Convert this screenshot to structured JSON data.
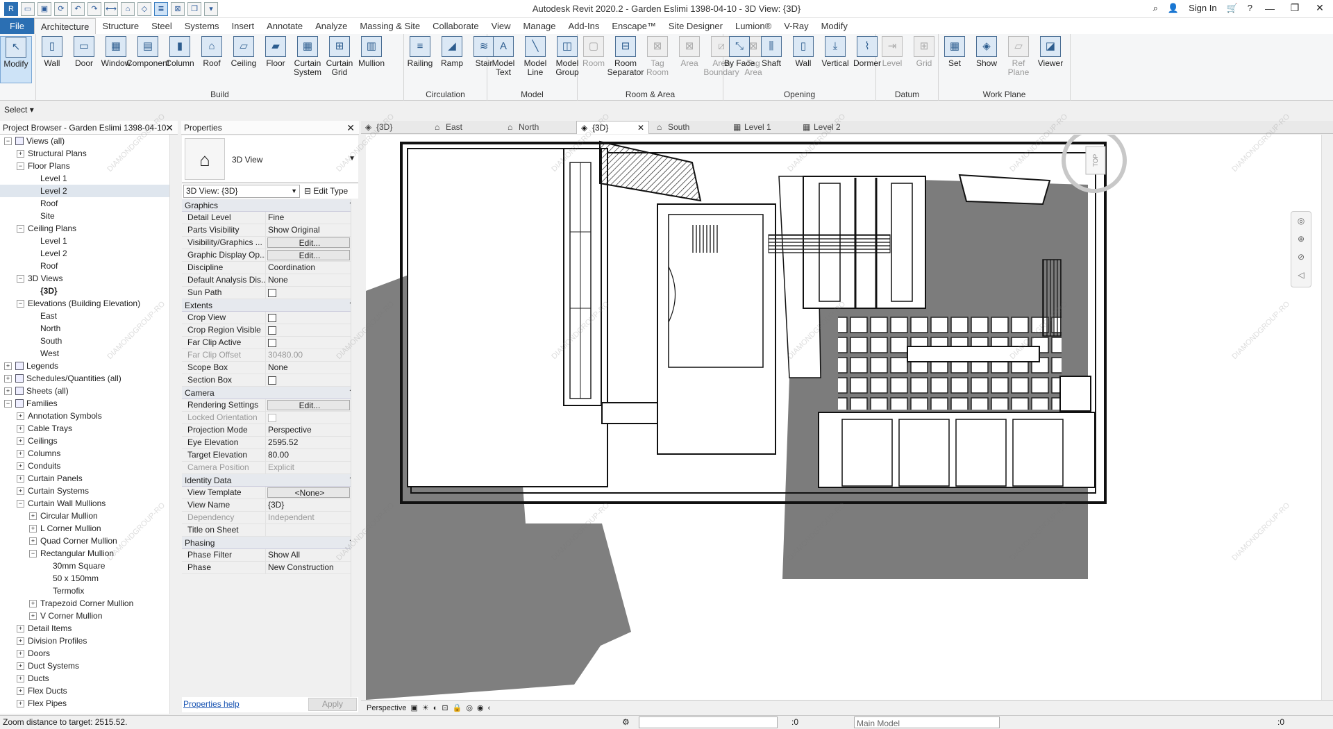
{
  "title": {
    "text": "Autodesk Revit 2020.2 - Garden Eslimi 1398-04-10 - 3D View: {3D}",
    "sign_in": "Sign In"
  },
  "menu": [
    "File",
    "Architecture",
    "Structure",
    "Steel",
    "Systems",
    "Insert",
    "Annotate",
    "Analyze",
    "Massing & Site",
    "Collaborate",
    "View",
    "Manage",
    "Add-Ins",
    "Enscape™",
    "Site Designer",
    "Lumion®",
    "V-Ray",
    "Modify"
  ],
  "ribbon": {
    "select_label": "Select",
    "groups": [
      {
        "name": "",
        "tools": [
          "Modify"
        ]
      },
      {
        "name": "Build",
        "tools": [
          "Wall",
          "Door",
          "Window",
          "Component",
          "Column",
          "Roof",
          "Ceiling",
          "Floor",
          "Curtain System",
          "Curtain Grid",
          "Mullion"
        ]
      },
      {
        "name": "Circulation",
        "tools": [
          "Railing",
          "Ramp",
          "Stair"
        ]
      },
      {
        "name": "Model",
        "tools": [
          "Model Text",
          "Model Line",
          "Model Group"
        ]
      },
      {
        "name": "Room & Area",
        "tools": [
          "Room",
          "Room Separator",
          "Tag Room",
          "Area",
          "Area Boundary",
          "Tag Area"
        ]
      },
      {
        "name": "Opening",
        "tools": [
          "By Face",
          "Shaft",
          "Wall",
          "Vertical",
          "Dormer"
        ]
      },
      {
        "name": "Datum",
        "tools": [
          "Level",
          "Grid"
        ]
      },
      {
        "name": "Work Plane",
        "tools": [
          "Set",
          "Show",
          "Ref Plane",
          "Viewer"
        ]
      }
    ]
  },
  "browser": {
    "title": "Project Browser - Garden Eslimi 1398-04-10",
    "items": [
      {
        "t": "Views (all)",
        "l": 0,
        "e": "-"
      },
      {
        "t": "Structural Plans",
        "l": 1,
        "e": "+"
      },
      {
        "t": "Floor Plans",
        "l": 1,
        "e": "-"
      },
      {
        "t": "Level 1",
        "l": 2,
        "e": ""
      },
      {
        "t": "Level 2",
        "l": 2,
        "e": "",
        "sel": true
      },
      {
        "t": "Roof",
        "l": 2,
        "e": ""
      },
      {
        "t": "Site",
        "l": 2,
        "e": ""
      },
      {
        "t": "Ceiling Plans",
        "l": 1,
        "e": "-"
      },
      {
        "t": "Level 1",
        "l": 2,
        "e": ""
      },
      {
        "t": "Level 2",
        "l": 2,
        "e": ""
      },
      {
        "t": "Roof",
        "l": 2,
        "e": ""
      },
      {
        "t": "3D Views",
        "l": 1,
        "e": "-"
      },
      {
        "t": "{3D}",
        "l": 2,
        "e": "",
        "bold": true
      },
      {
        "t": "Elevations (Building Elevation)",
        "l": 1,
        "e": "-"
      },
      {
        "t": "East",
        "l": 2,
        "e": ""
      },
      {
        "t": "North",
        "l": 2,
        "e": ""
      },
      {
        "t": "South",
        "l": 2,
        "e": ""
      },
      {
        "t": "West",
        "l": 2,
        "e": ""
      },
      {
        "t": "Legends",
        "l": 0,
        "e": "+",
        "icon": true
      },
      {
        "t": "Schedules/Quantities (all)",
        "l": 0,
        "e": "+",
        "icon": true
      },
      {
        "t": "Sheets (all)",
        "l": 0,
        "e": "+",
        "icon": true
      },
      {
        "t": "Families",
        "l": 0,
        "e": "-",
        "icon": true
      },
      {
        "t": "Annotation Symbols",
        "l": 1,
        "e": "+"
      },
      {
        "t": "Cable Trays",
        "l": 1,
        "e": "+"
      },
      {
        "t": "Ceilings",
        "l": 1,
        "e": "+"
      },
      {
        "t": "Columns",
        "l": 1,
        "e": "+"
      },
      {
        "t": "Conduits",
        "l": 1,
        "e": "+"
      },
      {
        "t": "Curtain Panels",
        "l": 1,
        "e": "+"
      },
      {
        "t": "Curtain Systems",
        "l": 1,
        "e": "+"
      },
      {
        "t": "Curtain Wall Mullions",
        "l": 1,
        "e": "-"
      },
      {
        "t": "Circular Mullion",
        "l": 2,
        "e": "+"
      },
      {
        "t": "L Corner Mullion",
        "l": 2,
        "e": "+"
      },
      {
        "t": "Quad Corner Mullion",
        "l": 2,
        "e": "+"
      },
      {
        "t": "Rectangular Mullion",
        "l": 2,
        "e": "-"
      },
      {
        "t": "30mm Square",
        "l": 3,
        "e": ""
      },
      {
        "t": "50 x 150mm",
        "l": 3,
        "e": ""
      },
      {
        "t": "Termofix",
        "l": 3,
        "e": ""
      },
      {
        "t": "Trapezoid Corner Mullion",
        "l": 2,
        "e": "+"
      },
      {
        "t": "V Corner Mullion",
        "l": 2,
        "e": "+"
      },
      {
        "t": "Detail Items",
        "l": 1,
        "e": "+"
      },
      {
        "t": "Division Profiles",
        "l": 1,
        "e": "+"
      },
      {
        "t": "Doors",
        "l": 1,
        "e": "+"
      },
      {
        "t": "Duct Systems",
        "l": 1,
        "e": "+"
      },
      {
        "t": "Ducts",
        "l": 1,
        "e": "+"
      },
      {
        "t": "Flex Ducts",
        "l": 1,
        "e": "+"
      },
      {
        "t": "Flex Pipes",
        "l": 1,
        "e": "+"
      }
    ]
  },
  "properties": {
    "title": "Properties",
    "type_name": "3D View",
    "instance": "3D View: {3D}",
    "edit_type": "Edit Type",
    "help": "Properties help",
    "apply": "Apply",
    "sections": [
      {
        "name": "Graphics",
        "rows": [
          {
            "k": "Detail Level",
            "v": "Fine"
          },
          {
            "k": "Parts Visibility",
            "v": "Show Original"
          },
          {
            "k": "Visibility/Graphics ...",
            "v": "Edit...",
            "btn": true
          },
          {
            "k": "Graphic Display Op...",
            "v": "Edit...",
            "btn": true
          },
          {
            "k": "Discipline",
            "v": "Coordination"
          },
          {
            "k": "Default Analysis Dis...",
            "v": "None"
          },
          {
            "k": "Sun Path",
            "v": "",
            "chk": true
          }
        ]
      },
      {
        "name": "Extents",
        "rows": [
          {
            "k": "Crop View",
            "v": "",
            "chk": true
          },
          {
            "k": "Crop Region Visible",
            "v": "",
            "chk": true
          },
          {
            "k": "Far Clip Active",
            "v": "",
            "chk": true
          },
          {
            "k": "Far Clip Offset",
            "v": "30480.00",
            "dis": true
          },
          {
            "k": "Scope Box",
            "v": "None"
          },
          {
            "k": "Section Box",
            "v": "",
            "chk": true
          }
        ]
      },
      {
        "name": "Camera",
        "rows": [
          {
            "k": "Rendering Settings",
            "v": "Edit...",
            "btn": true
          },
          {
            "k": "Locked Orientation",
            "v": "",
            "chk": true,
            "dis": true
          },
          {
            "k": "Projection Mode",
            "v": "Perspective"
          },
          {
            "k": "Eye Elevation",
            "v": "2595.52"
          },
          {
            "k": "Target Elevation",
            "v": "80.00"
          },
          {
            "k": "Camera Position",
            "v": "Explicit",
            "dis": true
          }
        ]
      },
      {
        "name": "Identity Data",
        "rows": [
          {
            "k": "View Template",
            "v": "<None>",
            "btn": true
          },
          {
            "k": "View Name",
            "v": "{3D}"
          },
          {
            "k": "Dependency",
            "v": "Independent",
            "dis": true
          },
          {
            "k": "Title on Sheet",
            "v": ""
          }
        ]
      },
      {
        "name": "Phasing",
        "rows": [
          {
            "k": "Phase Filter",
            "v": "Show All"
          },
          {
            "k": "Phase",
            "v": "New Construction"
          }
        ]
      }
    ]
  },
  "tabs": [
    "{3D}",
    "East",
    "North",
    "{3D}",
    "South",
    "Level 1",
    "Level 2"
  ],
  "viewcube": {
    "label": "TOP"
  },
  "viewctrl": {
    "mode": "Perspective"
  },
  "status": {
    "text": "Zoom distance to target: 2515.52.",
    "model": "Main Model",
    "zero1": ":0",
    "zero2": ":0"
  },
  "watermark": "DIAMONDGROUP-RO"
}
